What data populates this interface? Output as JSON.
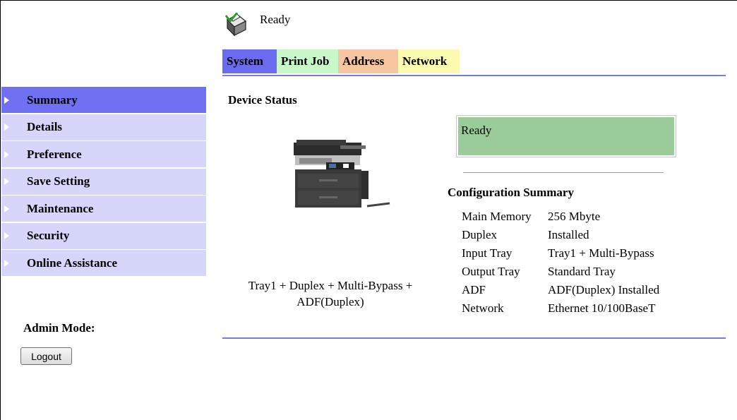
{
  "header": {
    "status": "Ready",
    "status_icon": "printer-ready-icon"
  },
  "tabs": [
    {
      "label": "System",
      "color": "#6b6bf0"
    },
    {
      "label": "Print Job",
      "color": "#c8f7c8"
    },
    {
      "label": "Address",
      "color": "#f7c6a0"
    },
    {
      "label": "Network",
      "color": "#fafab0"
    }
  ],
  "sidebar": {
    "items": [
      {
        "label": "Summary",
        "active": true
      },
      {
        "label": "Details"
      },
      {
        "label": "Preference"
      },
      {
        "label": "Save Setting"
      },
      {
        "label": "Maintenance"
      },
      {
        "label": "Security"
      },
      {
        "label": "Online Assistance"
      }
    ],
    "admin_label": "Admin Mode:",
    "logout_label": "Logout"
  },
  "main": {
    "section_title": "Device Status",
    "device_options_line1": "Tray1 + Duplex + Multi-Bypass +",
    "device_options_line2": "ADF(Duplex)",
    "device_status": "Ready",
    "config_title": "Configuration Summary",
    "config": [
      {
        "key": "Main Memory",
        "value": "256 Mbyte"
      },
      {
        "key": "Duplex",
        "value": "Installed"
      },
      {
        "key": "Input Tray",
        "value": "Tray1 + Multi-Bypass"
      },
      {
        "key": "Output Tray",
        "value": "Standard Tray"
      },
      {
        "key": "ADF",
        "value": "ADF(Duplex) Installed"
      },
      {
        "key": "Network",
        "value": "Ethernet 10/100BaseT"
      }
    ]
  },
  "colors": {
    "accent": "#7070f2",
    "sidebar_bg": "#d6d6fb",
    "status_ok": "#99cc99"
  }
}
